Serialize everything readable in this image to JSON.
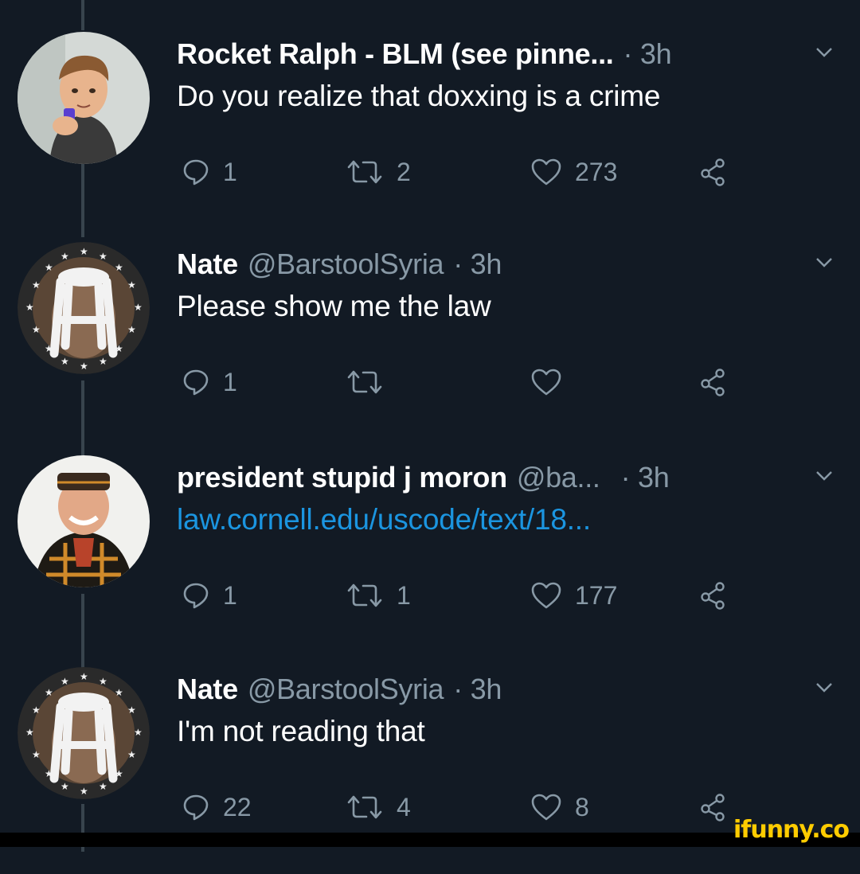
{
  "tweets": [
    {
      "name": "Rocket Ralph - BLM (see pinne...",
      "handle": "",
      "time": "· 3h",
      "text": "Do you realize that doxxing is a crime",
      "replies": "1",
      "retweets": "2",
      "likes": "273"
    },
    {
      "name": "Nate",
      "handle": "@BarstoolSyria",
      "time": "· 3h",
      "text": "Please show me the law",
      "replies": "1",
      "retweets": "",
      "likes": ""
    },
    {
      "name": "president stupid j moron",
      "handle": "@ba...",
      "time": "· 3h",
      "text": "law.cornell.edu/uscode/text/18...",
      "replies": "1",
      "retweets": "1",
      "likes": "177"
    },
    {
      "name": "Nate",
      "handle": "@BarstoolSyria",
      "time": "· 3h",
      "text": "I'm not reading that",
      "replies": "22",
      "retweets": "4",
      "likes": "8"
    }
  ],
  "watermark": "ifunny.co",
  "colors": {
    "background": "#121a24",
    "secondary_text": "#8899a6",
    "link": "#1b95e0",
    "watermark": "#ffcc00"
  },
  "icons": [
    "reply-icon",
    "retweet-icon",
    "like-icon",
    "share-icon",
    "chevron-down-icon"
  ]
}
